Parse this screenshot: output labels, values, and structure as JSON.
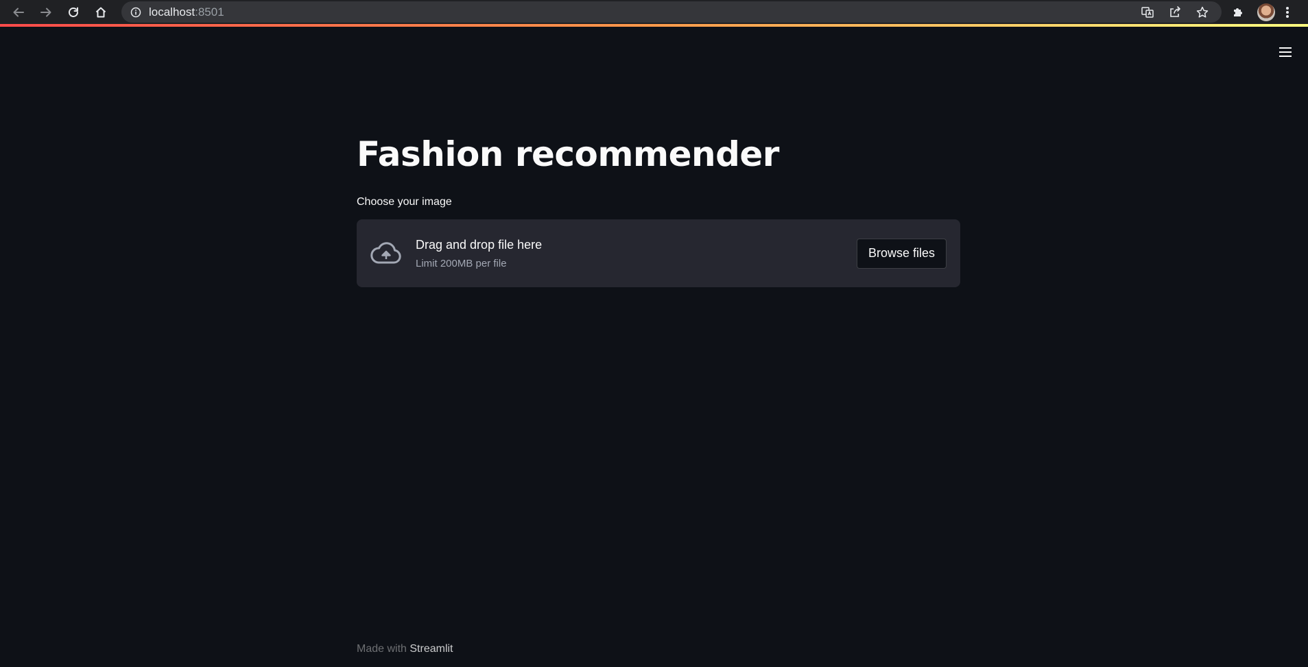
{
  "browser": {
    "url_host": "localhost",
    "url_port": ":8501",
    "icons": {
      "back": "back-arrow-icon",
      "forward": "forward-arrow-icon",
      "reload": "reload-icon",
      "home": "home-icon",
      "site_info": "info-icon",
      "translate": "translate-icon",
      "share": "share-icon",
      "bookmark": "star-icon",
      "extensions": "puzzle-icon",
      "profile": "avatar",
      "menu": "kebab-menu-icon"
    }
  },
  "app": {
    "accent_gradient": [
      "#ff4b4b",
      "#fffd80"
    ],
    "background": "#0e1117",
    "title": "Fashion recommender",
    "uploader": {
      "label": "Choose your image",
      "instructions": "Drag and drop file here",
      "limit": "Limit 200MB per file",
      "button_label": "Browse files"
    },
    "footer": {
      "prefix": "Made with",
      "link_label": "Streamlit"
    }
  }
}
